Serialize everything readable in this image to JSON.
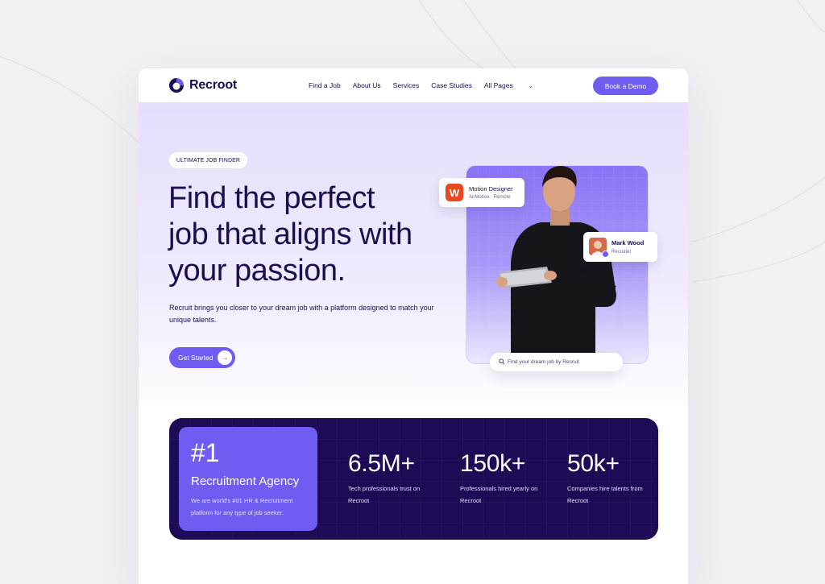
{
  "brand": {
    "name": "Recroot",
    "accent": "#6f5cf1",
    "navy": "#1e0b56"
  },
  "nav": {
    "links": [
      "Find a Job",
      "About Us",
      "Services",
      "Case Studies",
      "All Pages"
    ],
    "cta": "Book a Demo"
  },
  "hero": {
    "tag": "ULTIMATE JOB FINDER",
    "headline_lines": [
      "Find the perfect",
      "job that aligns with",
      "your passion."
    ],
    "subtext": "Recruit brings you closer to your dream job with a platform designed to match your unique talents.",
    "cta": "Get Started",
    "job_card": {
      "icon_letter": "W",
      "title": "Motion Designer",
      "company": "AirMotion",
      "type": "Remote"
    },
    "recruiter_card": {
      "name": "Mark Wood",
      "role": "Recruiter"
    },
    "search_placeholder": "Find your dream job by Recruit"
  },
  "stats": {
    "feature": {
      "rank": "#1",
      "title": "Recruitment Agency",
      "description": "We are world's #01 HR & Recruitment platform for any type of job seeker."
    },
    "items": [
      {
        "value": "6.5M+",
        "label": "Tech professionals trust on Recroot"
      },
      {
        "value": "150k+",
        "label": "Professionals hired yearly on Recroot"
      },
      {
        "value": "50k+",
        "label": "Companies hire talents from Recroot"
      }
    ]
  },
  "icons": {
    "logo": "recroot-logo-icon",
    "nav_chevron": "chevron-down-icon",
    "cta_arrow": "arrow-right-icon",
    "search": "search-icon"
  }
}
